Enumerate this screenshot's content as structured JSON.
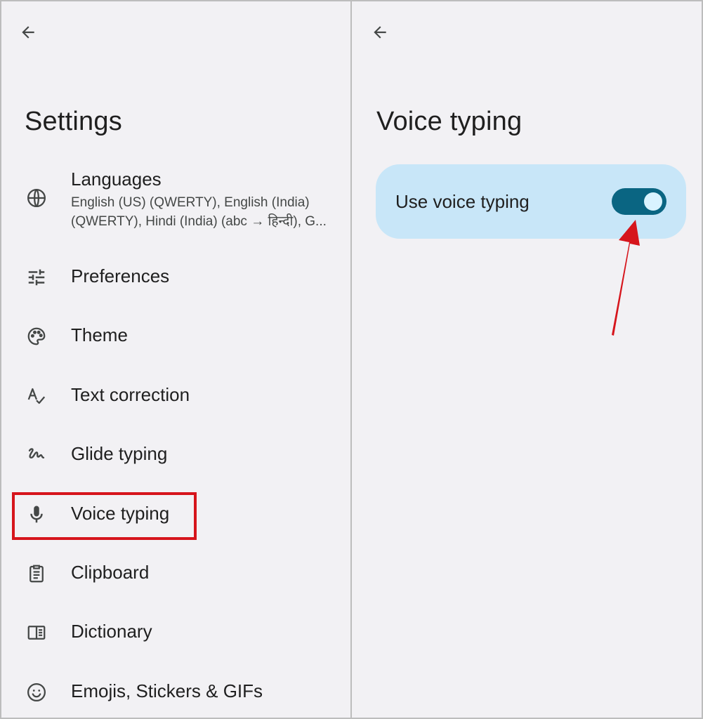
{
  "left_pane": {
    "title": "Settings",
    "items": [
      {
        "label": "Languages",
        "subtitle_lines": [
          "English (US) (QWERTY), English (India)",
          "(QWERTY), Hindi (India) (abc → हिन्दी), G..."
        ],
        "icon": "globe-icon"
      },
      {
        "label": "Preferences",
        "icon": "tune-sliders-icon"
      },
      {
        "label": "Theme",
        "icon": "palette-icon"
      },
      {
        "label": "Text correction",
        "icon": "spellcheck-icon"
      },
      {
        "label": "Glide typing",
        "icon": "gesture-icon"
      },
      {
        "label": "Voice typing",
        "icon": "microphone-icon"
      },
      {
        "label": "Clipboard",
        "icon": "clipboard-icon"
      },
      {
        "label": "Dictionary",
        "icon": "dictionary-icon"
      },
      {
        "label": "Emojis, Stickers & GIFs",
        "icon": "emoji-icon"
      }
    ],
    "highlighted_item": "Voice typing"
  },
  "right_pane": {
    "title": "Voice typing",
    "setting": {
      "label": "Use voice typing",
      "enabled": true
    }
  },
  "colors": {
    "background": "#f2f1f4",
    "card": "#c8e6f8",
    "toggle_on": "#0a6582",
    "annotation_red": "#d6151c"
  }
}
